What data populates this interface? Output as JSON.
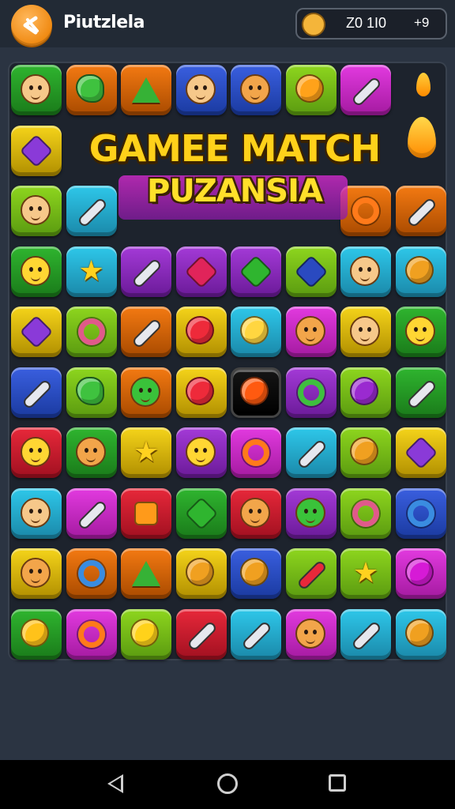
{
  "header": {
    "app_title": "Piutzlela",
    "score": "Z0 1I0",
    "coins": "+9"
  },
  "banner": {
    "line1": "GAMEE MATCH",
    "line2": "PUZANSIA"
  },
  "colors": {
    "green": "#2fb52f",
    "orange": "#f47a12",
    "yellow": "#f5d41a",
    "blue": "#3a5fe0",
    "purple": "#a43ad8",
    "magenta": "#e23ae0",
    "lime": "#8ed61e",
    "cyan": "#2ec8ea",
    "red": "#e8283a",
    "black": "#151515"
  },
  "board": {
    "rows": [
      [
        {
          "bg": "green",
          "icon": "face-icon"
        },
        {
          "bg": "orange",
          "icon": "bird-icon"
        },
        {
          "bg": "orange",
          "icon": "triangle-icon"
        },
        {
          "bg": "blue",
          "icon": "face-icon"
        },
        {
          "bg": "blue",
          "icon": "bear-icon"
        },
        {
          "bg": "lime",
          "icon": "orange-fruit-icon"
        },
        {
          "bg": "magenta",
          "icon": "sword-icon"
        }
      ],
      [
        {
          "bg": "yellow",
          "icon": "leaf-icon"
        },
        {
          "bg": "green",
          "icon": "gem-icon"
        },
        {
          "bg": "green",
          "icon": "gem-icon"
        },
        {
          "bg": "green",
          "icon": "gem-icon"
        },
        {
          "bg": "cyan",
          "icon": "gem-icon"
        },
        {
          "bg": "green",
          "icon": "gem-icon"
        },
        {
          "bg": "green",
          "icon": "gem-icon"
        }
      ],
      [
        {
          "bg": "lime",
          "icon": "face-icon"
        },
        {
          "bg": "cyan",
          "icon": "sword-icon"
        },
        {
          "bg": "purple",
          "icon": "gem-icon"
        },
        {
          "bg": "purple",
          "icon": "gem-icon"
        },
        {
          "bg": "purple",
          "icon": "gem-icon"
        },
        {
          "bg": "purple",
          "icon": "gem-icon"
        },
        {
          "bg": "orange",
          "icon": "swirl-icon"
        },
        {
          "bg": "orange",
          "icon": "sword-icon"
        }
      ],
      [
        {
          "bg": "green",
          "icon": "smiley-icon"
        },
        {
          "bg": "cyan",
          "icon": "star-icon"
        },
        {
          "bg": "purple",
          "icon": "sword-icon"
        },
        {
          "bg": "purple",
          "icon": "gem-icon"
        },
        {
          "bg": "purple",
          "icon": "leaf-icon"
        },
        {
          "bg": "lime",
          "icon": "gem-icon"
        },
        {
          "bg": "cyan",
          "icon": "face-icon"
        },
        {
          "bg": "cyan",
          "icon": "coin-icon"
        }
      ],
      [
        {
          "bg": "yellow",
          "icon": "gem-icon"
        },
        {
          "bg": "lime",
          "icon": "ring-icon"
        },
        {
          "bg": "orange",
          "icon": "sword-icon"
        },
        {
          "bg": "yellow",
          "icon": "ball-icon"
        },
        {
          "bg": "cyan",
          "icon": "shield-icon"
        },
        {
          "bg": "magenta",
          "icon": "bear-icon"
        },
        {
          "bg": "yellow",
          "icon": "face-icon"
        },
        {
          "bg": "green",
          "icon": "smiley-icon"
        }
      ],
      [
        {
          "bg": "blue",
          "icon": "sword-icon"
        },
        {
          "bg": "lime",
          "icon": "bird-icon"
        },
        {
          "bg": "orange",
          "icon": "frog-icon"
        },
        {
          "bg": "yellow",
          "icon": "ball-icon"
        },
        {
          "bg": "black",
          "icon": "ball-icon"
        },
        {
          "bg": "purple",
          "icon": "ring-icon"
        },
        {
          "bg": "lime",
          "icon": "ball-icon"
        },
        {
          "bg": "green",
          "icon": "sword-icon"
        }
      ],
      [
        {
          "bg": "red",
          "icon": "smiley-icon"
        },
        {
          "bg": "green",
          "icon": "bear-icon"
        },
        {
          "bg": "yellow",
          "icon": "star-icon"
        },
        {
          "bg": "purple",
          "icon": "smiley-icon"
        },
        {
          "bg": "magenta",
          "icon": "swirl-icon"
        },
        {
          "bg": "cyan",
          "icon": "sword-icon"
        },
        {
          "bg": "lime",
          "icon": "coin-icon"
        },
        {
          "bg": "yellow",
          "icon": "gem-icon"
        }
      ],
      [
        {
          "bg": "cyan",
          "icon": "face-icon"
        },
        {
          "bg": "magenta",
          "icon": "sword-icon"
        },
        {
          "bg": "red",
          "icon": "box-icon"
        },
        {
          "bg": "green",
          "icon": "leaf-icon"
        },
        {
          "bg": "red",
          "icon": "bear-icon"
        },
        {
          "bg": "purple",
          "icon": "frog-icon"
        },
        {
          "bg": "lime",
          "icon": "ring-icon"
        },
        {
          "bg": "blue",
          "icon": "ring-icon"
        }
      ],
      [
        {
          "bg": "yellow",
          "icon": "bear-icon"
        },
        {
          "bg": "orange",
          "icon": "ring-icon"
        },
        {
          "bg": "orange",
          "icon": "triangle-icon"
        },
        {
          "bg": "yellow",
          "icon": "coin-icon"
        },
        {
          "bg": "blue",
          "icon": "coin-icon"
        },
        {
          "bg": "lime",
          "icon": "exclaim-icon"
        },
        {
          "bg": "lime",
          "icon": "star-icon"
        },
        {
          "bg": "magenta",
          "icon": "ball-icon"
        }
      ],
      [
        {
          "bg": "green",
          "icon": "heart-icon"
        },
        {
          "bg": "magenta",
          "icon": "swirl-icon"
        },
        {
          "bg": "lime",
          "icon": "lemon-icon"
        },
        {
          "bg": "red",
          "icon": "sword-icon"
        },
        {
          "bg": "cyan",
          "icon": "sword-icon"
        },
        {
          "bg": "magenta",
          "icon": "bear-icon"
        },
        {
          "bg": "cyan",
          "icon": "sword-icon"
        },
        {
          "bg": "cyan",
          "icon": "coin-icon"
        }
      ]
    ]
  },
  "navigation": {
    "back": "back-icon",
    "home": "home-icon",
    "recents": "recents-icon"
  }
}
